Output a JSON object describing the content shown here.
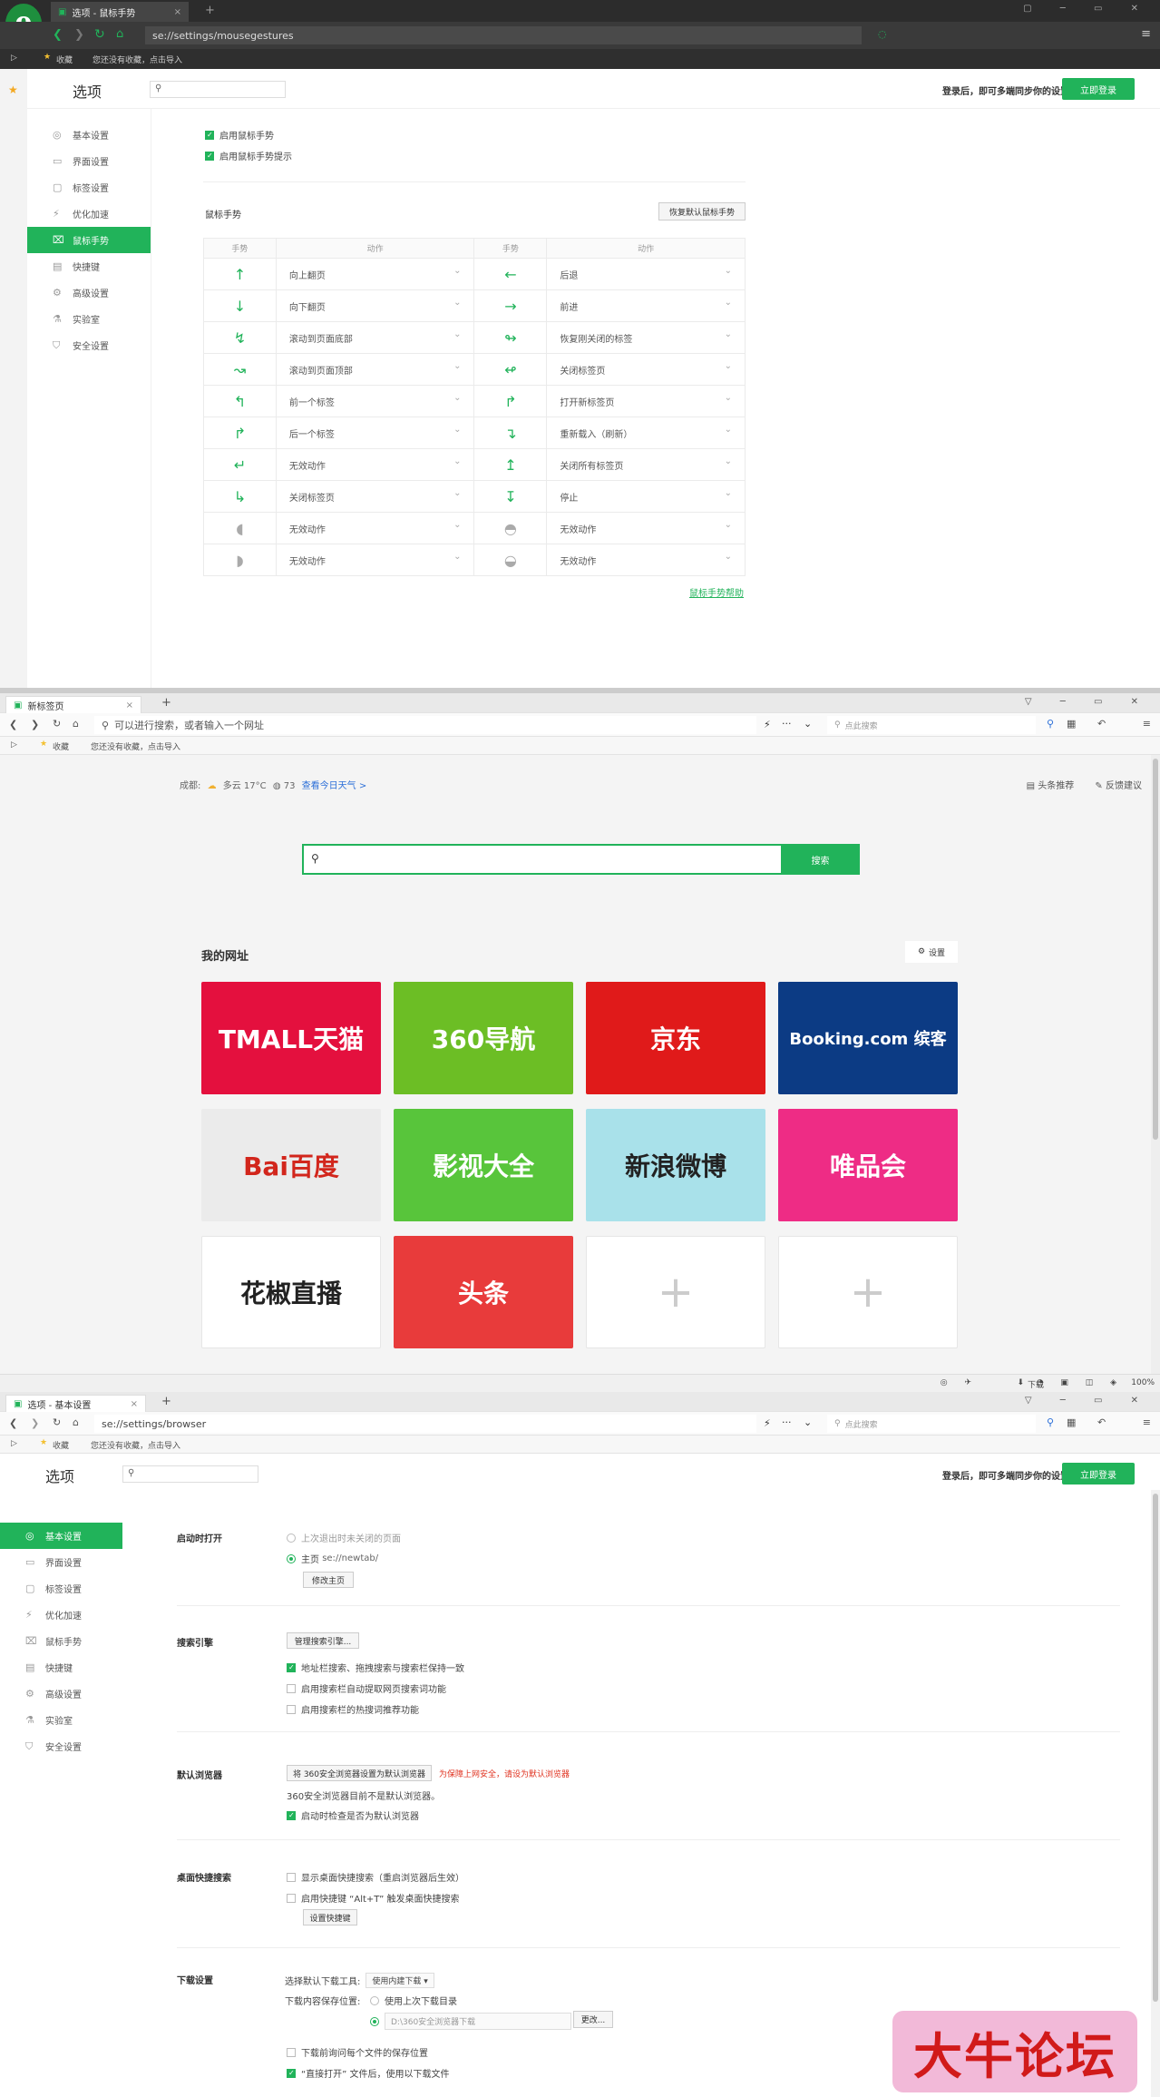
{
  "s1": {
    "tab_title": "选项 - 鼠标手势",
    "url": "se://settings/mousegestures",
    "fav_label": "收藏",
    "fav_hint": "您还没有收藏，点击导入",
    "page_title": "选项",
    "login_hint": "登录后，即可多端同步你的设置",
    "login_btn": "立即登录",
    "sidebar": [
      "基本设置",
      "界面设置",
      "标签设置",
      "优化加速",
      "鼠标手势",
      "快捷键",
      "高级设置",
      "实验室",
      "安全设置"
    ],
    "sidebar_active": 4,
    "check1": "启用鼠标手势",
    "check2": "启用鼠标手势提示",
    "gesture_section": "鼠标手势",
    "reset_btn": "恢复默认鼠标手势",
    "col_gesture": "手势",
    "col_action": "动作",
    "left_rows": [
      {
        "icon": "↑",
        "action": "向上翻页"
      },
      {
        "icon": "↓",
        "action": "向下翻页"
      },
      {
        "icon": "↯",
        "action": "滚动到页面底部"
      },
      {
        "icon": "↝",
        "action": "滚动到页面顶部"
      },
      {
        "icon": "↰",
        "action": "前一个标签"
      },
      {
        "icon": "↱",
        "action": "后一个标签"
      },
      {
        "icon": "↵",
        "action": "无效动作"
      },
      {
        "icon": "↳",
        "action": "关闭标签页"
      },
      {
        "icon": "◖",
        "action": "无效动作"
      },
      {
        "icon": "◗",
        "action": "无效动作"
      }
    ],
    "right_rows": [
      {
        "icon": "←",
        "action": "后退"
      },
      {
        "icon": "→",
        "action": "前进"
      },
      {
        "icon": "↬",
        "action": "恢复刚关闭的标签"
      },
      {
        "icon": "↫",
        "action": "关闭标签页"
      },
      {
        "icon": "↱",
        "action": "打开新标签页"
      },
      {
        "icon": "↴",
        "action": "重新载入（刷新）"
      },
      {
        "icon": "↥",
        "action": "关闭所有标签页"
      },
      {
        "icon": "↧",
        "action": "停止"
      },
      {
        "icon": "◓",
        "action": "无效动作"
      },
      {
        "icon": "◒",
        "action": "无效动作"
      }
    ],
    "help_link": "鼠标手势帮助"
  },
  "s2": {
    "tab_title": "新标签页",
    "url_placeholder": "可以进行搜索，或者输入一个网址",
    "search_placeholder": "点此搜索",
    "fav_label": "收藏",
    "fav_hint": "您还没有收藏，点击导入",
    "weather_city": "成都:",
    "weather_text": "多云 17°C",
    "aqi": "73",
    "weather_link": "查看今日天气 >",
    "top_right_1": "头条推荐",
    "top_right_2": "反馈建议",
    "search_btn": "搜索",
    "my_sites": "我的网址",
    "settings_label": "设置",
    "tiles": [
      {
        "label": "TMALL天猫",
        "bg": "#e4103e",
        "color": "#ffffff"
      },
      {
        "label": "360导航",
        "bg": "#6cbe25",
        "color": "#ffffff"
      },
      {
        "label": "京东",
        "bg": "#e01a1a",
        "color": "#ffffff"
      },
      {
        "label": "Booking.com 缤客",
        "bg": "#0c3b84",
        "color": "#ffffff"
      },
      {
        "label": "Bai百度",
        "bg": "#ebebeb",
        "color": "#d2261c"
      },
      {
        "label": "影视大全",
        "bg": "#58c53b",
        "color": "#ffffff"
      },
      {
        "label": "新浪微博",
        "bg": "#a9e1ea",
        "color": "#222222"
      },
      {
        "label": "唯品会",
        "bg": "#ee2c85",
        "color": "#ffffff"
      },
      {
        "label": "花椒直播",
        "bg": "#ffffff",
        "color": "#222222"
      },
      {
        "label": "头条",
        "bg": "#e83b3b",
        "color": "#ffffff"
      },
      {
        "label": "+",
        "bg": "#ffffff",
        "color": "#cccccc"
      },
      {
        "label": "+",
        "bg": "#ffffff",
        "color": "#cccccc"
      }
    ],
    "status_download": "下载",
    "zoom": "100%"
  },
  "s3": {
    "tab_title": "选项 - 基本设置",
    "url": "se://settings/browser",
    "search_placeholder": "点此搜索",
    "fav_label": "收藏",
    "fav_hint": "您还没有收藏，点击导入",
    "page_title": "选项",
    "login_hint": "登录后，即可多端同步你的设置",
    "login_btn": "立即登录",
    "sidebar": [
      "基本设置",
      "界面设置",
      "标签设置",
      "优化加速",
      "鼠标手势",
      "快捷键",
      "高级设置",
      "实验室",
      "安全设置"
    ],
    "sidebar_active": 0,
    "startup": {
      "title": "启动时打开",
      "opt1": "上次退出时未关闭的页面",
      "opt2": "主页",
      "opt2_val": "se://newtab/",
      "btn": "修改主页"
    },
    "search": {
      "title": "搜索引擎",
      "btn": "管理搜索引擎...",
      "c1": "地址栏搜索、拖拽搜索与搜索栏保持一致",
      "c2": "启用搜索栏自动提取网页搜索词功能",
      "c3": "启用搜索栏的热搜词推荐功能"
    },
    "default_browser": {
      "title": "默认浏览器",
      "btn": "将 360安全浏览器设置为默认浏览器",
      "warn": "为保障上网安全，请设为默认浏览器",
      "status": "360安全浏览器目前不是默认浏览器。",
      "c1": "启动时检查是否为默认浏览器"
    },
    "desktop_search": {
      "title": "桌面快捷搜索",
      "c1": "显示桌面快捷搜索（重启浏览器后生效）",
      "c2": "启用快捷键 “Alt+T” 触发桌面快捷搜索",
      "btn": "设置快捷键"
    },
    "download": {
      "title": "下载设置",
      "tool_label": "选择默认下载工具:",
      "tool_value": "使用内建下载",
      "loc_label": "下载内容保存位置:",
      "loc_opt1": "使用上次下载目录",
      "loc_opt2": "D:\\360安全浏览器下载",
      "change_btn": "更改...",
      "c1": "下载前询问每个文件的保存位置",
      "c2": "“直接打开” 文件后，使用以下载文件"
    }
  },
  "watermark": "大牛论坛",
  "colors": {
    "green": "#21b35a",
    "dark": "#2c2c2c"
  }
}
